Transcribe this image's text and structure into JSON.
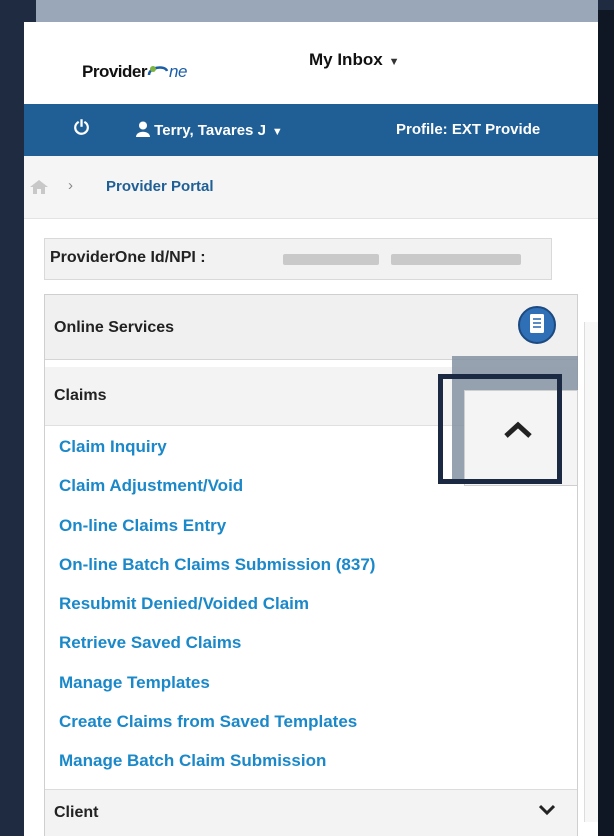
{
  "header": {
    "logo_text": "Provider",
    "logo_suffix": "ne",
    "inbox_label": "My Inbox"
  },
  "bluebar": {
    "user_name": "Terry, Tavares J",
    "profile_label": "Profile: EXT Provide"
  },
  "breadcrumb": {
    "separator": "›",
    "current": "Provider Portal"
  },
  "provider_id": {
    "label": "ProviderOne Id/NPI :"
  },
  "panel": {
    "title": "Online Services",
    "claims_section": "Claims",
    "claims_links": [
      "Claim Inquiry",
      "Claim Adjustment/Void",
      "On-line Claims Entry",
      "On-line Batch Claims Submission (837)",
      "Resubmit Denied/Voided Claim",
      "Retrieve Saved Claims",
      "Manage Templates",
      "Create Claims from Saved Templates",
      "Manage Batch Claim Submission"
    ],
    "client_section": "Client"
  },
  "icons": {
    "power": "power-icon",
    "user": "user-icon",
    "home": "home-icon",
    "document": "document-icon",
    "scroll_top": "chevron-up-icon",
    "collapse": "chevron-down-icon"
  },
  "colors": {
    "nav_blue": "#1f5f96",
    "link_blue": "#1a88c9",
    "highlight_border": "#1b2a42"
  }
}
